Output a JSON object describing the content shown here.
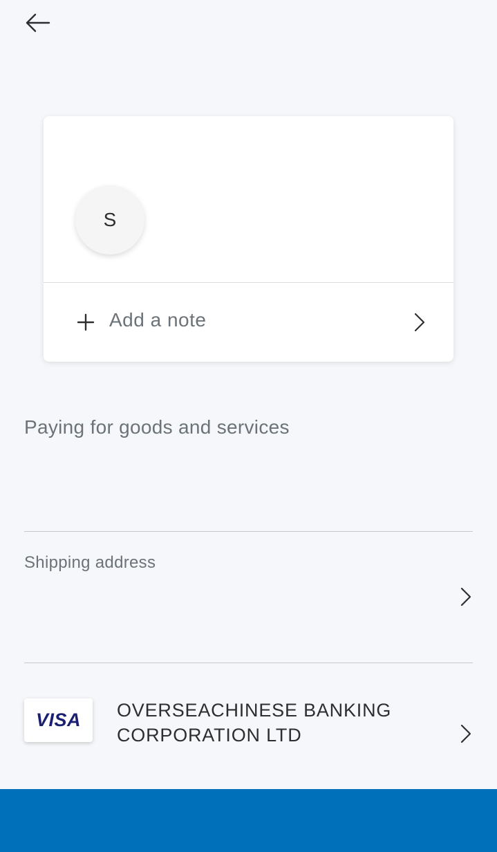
{
  "header": {
    "back_icon": "arrow-left-icon"
  },
  "recipient": {
    "avatar_initial": "S"
  },
  "note": {
    "label": "Add a note",
    "plus_icon": "plus-icon",
    "chevron_icon": "chevron-right-icon"
  },
  "payment_purpose": "Paying for goods and services",
  "shipping": {
    "label": "Shipping address",
    "chevron_icon": "chevron-right-icon"
  },
  "payment_method": {
    "brand": "VISA",
    "bank_name": "OVERSEACHINESE BANKING CORPORATION LTD",
    "chevron_icon": "chevron-right-icon"
  },
  "colors": {
    "background": "#f5f7fa",
    "primary_blue": "#0070ba",
    "visa_blue": "#1a1f71",
    "muted_text": "#6c7378"
  }
}
